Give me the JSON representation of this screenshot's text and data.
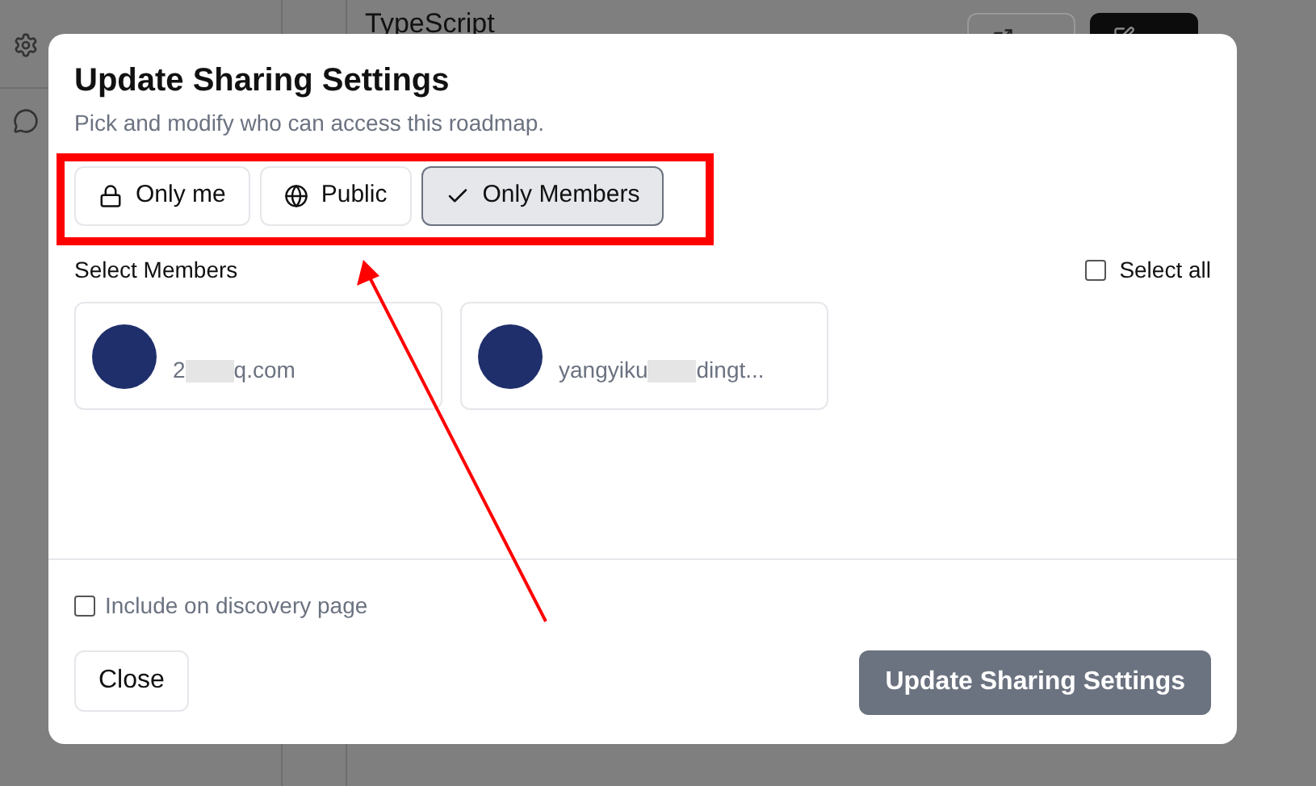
{
  "background": {
    "title": "TypeScript"
  },
  "dialog": {
    "title": "Update Sharing Settings",
    "subtitle": "Pick and modify who can access this roadmap.",
    "visibility_options": [
      {
        "label": "Only me",
        "kind": "lock",
        "selected": false
      },
      {
        "label": "Public",
        "kind": "globe",
        "selected": false
      },
      {
        "label": "Only Members",
        "kind": "check",
        "selected": true
      }
    ],
    "members_label": "Select Members",
    "select_all": {
      "label": "Select all",
      "checked": false
    },
    "members": [
      {
        "email_parts": [
          "2",
          "q.com"
        ],
        "selected": false
      },
      {
        "email_parts": [
          "yangyiku",
          "dingt..."
        ],
        "selected": false
      }
    ],
    "discovery": {
      "label": "Include on discovery page",
      "checked": false
    },
    "close_button": "Close",
    "submit_button": "Update Sharing Settings"
  }
}
